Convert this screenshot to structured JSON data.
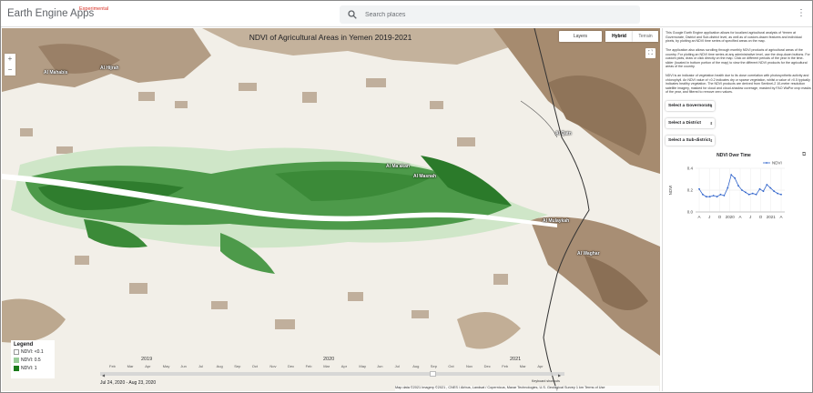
{
  "app": {
    "title": "Earth Engine Apps",
    "badge": "Experimental"
  },
  "search": {
    "placeholder": "Search places",
    "icon": "search-icon"
  },
  "menu_icon": "more-vert-icon",
  "map": {
    "title": "NDVI of Agricultural Areas in Yemen 2019-2021",
    "map_types": {
      "layers": "Layers",
      "hybrid": "Hybrid",
      "terrain": "Terrain"
    },
    "zoom_in": "+",
    "zoom_out": "−",
    "fullscreen": "⛶",
    "places": [
      {
        "label": "Al Mahabis"
      },
      {
        "label": "Al Hijrah"
      },
      {
        "label": "Al Ma'akan"
      },
      {
        "label": "Al Masnah"
      },
      {
        "label": "Al Qatn"
      },
      {
        "label": "Al Mulaykah"
      },
      {
        "label": "Al Waghar"
      }
    ],
    "legend": {
      "title": "Legend",
      "items": [
        {
          "label": "NDVI: <0.1",
          "color": "#ffffff"
        },
        {
          "label": "NDVI: 0.5",
          "color": "#99cc99"
        },
        {
          "label": "NDVI: 1",
          "color": "#1a7a1a"
        }
      ]
    },
    "timeline": {
      "years": [
        "2019",
        "2020",
        "2021"
      ],
      "months": [
        "Feb",
        "Mar",
        "Apr",
        "May",
        "Jun",
        "Jul",
        "Aug",
        "Sep",
        "Oct",
        "Nov",
        "Dec",
        "Feb",
        "Mar",
        "Apr",
        "May",
        "Jun",
        "Jul",
        "Aug",
        "Sep",
        "Oct",
        "Nov",
        "Dec",
        "Feb",
        "Mar",
        "Apr"
      ],
      "range": "Jul 24, 2020 - Aug 23, 2020",
      "selected_fraction": 0.72
    },
    "attribution": "Map data ©2021 Imagery ©2021 , CNES / Airbus, Landsat / Copernicus, Maxar Technologies, U.S. Geological Survey",
    "scale": "1 km",
    "terms": "Terms of Use",
    "keyboard": "Keyboard shortcuts"
  },
  "panel": {
    "description_1": "This Google Earth Engine application allows for localized agricultural analysis of Yemen at Governorate, District and Sub-district level, as well as of custom-drawn features and individual pixels, by plotting an NDVI time series of specified areas on the map.",
    "description_2": "The application also allows scrolling through monthly NDVI products of agricultural areas of the country. For plotting an NDVI time series at any administrative level, use the drop-down buttons. For custom plots, draw or click directly on the map. Click on different periods of the year in the time-slider (located in bottom portion of the map) to view the different NDVI products for the agricultural areas of the country.",
    "description_3": "NDVI is an indicator of vegetation health due to its close correlation with photosynthetic activity and chlorophyll. An NDVI value of <0.2 indicates dry or sparse vegetation, whilst a value of >0.5 typically indicates healthy vegetation. The NDVI products are derived from Sentinel-2 10-meter resolution satellite imagery, masked for cloud and cloud-shadow coverage, masked by FAO WaPor crop masks of the year, and filtered to remove zero values.",
    "selects": {
      "governorate": "Select a Governorate",
      "district": "Select a District",
      "subdistrict": "Select a Sub-district"
    },
    "popout_icon": "open-in-new-icon"
  },
  "chart_data": {
    "type": "line",
    "title": "NDVI Over Time",
    "ylabel": "NDVI",
    "xlabel": "",
    "ylim": [
      0,
      0.4
    ],
    "yticks": [
      "0.4",
      "0.2",
      "0.0"
    ],
    "xticks": [
      "A",
      "J",
      "O",
      "2020",
      "A",
      "J",
      "O",
      "2021",
      "A"
    ],
    "legend": "top-right",
    "grid": true,
    "series": [
      {
        "name": "NDVI",
        "color": "#3366cc",
        "values": [
          0.21,
          0.16,
          0.14,
          0.14,
          0.15,
          0.14,
          0.16,
          0.15,
          0.22,
          0.34,
          0.31,
          0.24,
          0.2,
          0.18,
          0.16,
          0.17,
          0.16,
          0.21,
          0.19,
          0.25,
          0.22,
          0.19,
          0.17,
          0.16
        ]
      }
    ]
  }
}
